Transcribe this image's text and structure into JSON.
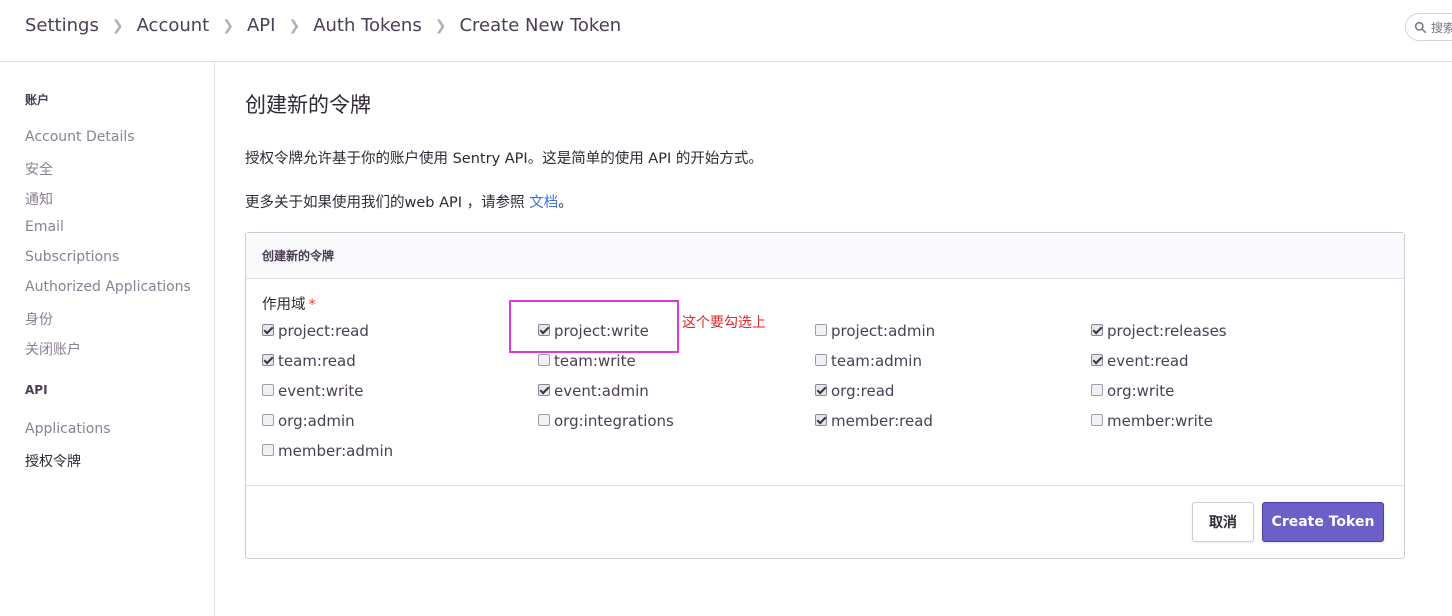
{
  "breadcrumb": [
    "Settings",
    "Account",
    "API",
    "Auth Tokens",
    "Create New Token"
  ],
  "search": {
    "placeholder": "搜索"
  },
  "sidebar": {
    "sections": [
      {
        "heading": "账户",
        "items": [
          "Account Details",
          "安全",
          "通知",
          "Email",
          "Subscriptions",
          "Authorized Applications",
          "身份",
          "关闭账户"
        ]
      },
      {
        "heading": "API",
        "items": [
          "Applications",
          "授权令牌"
        ]
      }
    ],
    "active_item": "授权令牌"
  },
  "page": {
    "title": "创建新的令牌",
    "description": "授权令牌允许基于你的账户使用 Sentry API。这是简单的使用 API 的开始方式。",
    "docs_prefix": "更多关于如果使用我们的web API ，请参照 ",
    "docs_link": "文档",
    "docs_suffix": "。"
  },
  "panel": {
    "header": "创建新的令牌",
    "scope_label": "作用域",
    "required_mark": "*",
    "scopes": [
      [
        {
          "name": "project:read",
          "checked": true
        },
        {
          "name": "project:write",
          "checked": true
        },
        {
          "name": "project:admin",
          "checked": false
        },
        {
          "name": "project:releases",
          "checked": true
        }
      ],
      [
        {
          "name": "team:read",
          "checked": true
        },
        {
          "name": "team:write",
          "checked": false
        },
        {
          "name": "team:admin",
          "checked": false
        },
        {
          "name": "event:read",
          "checked": true
        }
      ],
      [
        {
          "name": "event:write",
          "checked": false
        },
        {
          "name": "event:admin",
          "checked": true
        },
        {
          "name": "org:read",
          "checked": true
        },
        {
          "name": "org:write",
          "checked": false
        }
      ],
      [
        {
          "name": "org:admin",
          "checked": false
        },
        {
          "name": "org:integrations",
          "checked": false
        },
        {
          "name": "member:read",
          "checked": true
        },
        {
          "name": "member:write",
          "checked": false
        }
      ],
      [
        {
          "name": "member:admin",
          "checked": false
        }
      ]
    ],
    "annotation": "这个要勾选上",
    "cancel_label": "取消",
    "create_label": "Create Token"
  },
  "colors": {
    "accent": "#6c5fc7",
    "link": "#3d74db",
    "annotation": "#e0262a",
    "highlight_box": "#dd3ad8"
  }
}
